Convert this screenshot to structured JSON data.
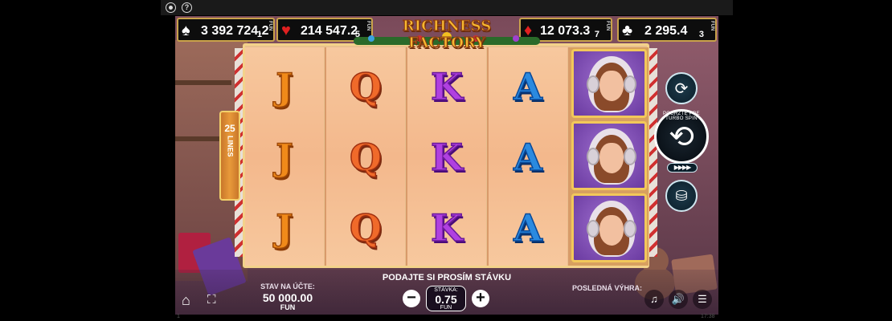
{
  "counters": [
    {
      "suit": "♠",
      "value": "3 392 724.2",
      "sub": "1",
      "fun": "FUN"
    },
    {
      "suit": "♥",
      "value": "214 547.2",
      "sub": "5",
      "fun": "FUN"
    },
    {
      "suit": "♦",
      "value": "12 073.3",
      "sub": "7",
      "fun": "FUN"
    },
    {
      "suit": "♣",
      "value": "2 295.4",
      "sub": "3",
      "fun": "FUN"
    }
  ],
  "logo_text": "RICHNESS FACTORY",
  "lines_banner": {
    "number": "25",
    "word": "LINES"
  },
  "reels": [
    [
      "J",
      "J",
      "J"
    ],
    [
      "Q",
      "Q",
      "Q"
    ],
    [
      "K",
      "K",
      "K"
    ],
    [
      "A",
      "A",
      "A"
    ]
  ],
  "turbo_text": "PODRŽTE PRE TURBO SPIN",
  "turbo_arrows": "▶▶▶▶",
  "bet_prompt": "PODAJTE SI PROSÍM STÁVKU",
  "balance": {
    "label": "STAV NA ÚČTE:",
    "value": "50 000.00",
    "currency": "FUN"
  },
  "bet": {
    "label": "STÁVKA:",
    "value": "0.75",
    "currency": "FUN"
  },
  "last_win_label": "POSLEDNÁ VÝHRA:",
  "icons": {
    "record": "record-icon",
    "help": "help-icon",
    "home": "home-icon",
    "fullscreen": "fullscreen-icon",
    "autoplay": "autoplay-icon",
    "spin": "spin-icon",
    "coins": "coins-icon",
    "music": "music-icon",
    "sound": "sound-icon",
    "menu": "menu-icon"
  },
  "footer_left": "1",
  "footer_right": "17:38"
}
